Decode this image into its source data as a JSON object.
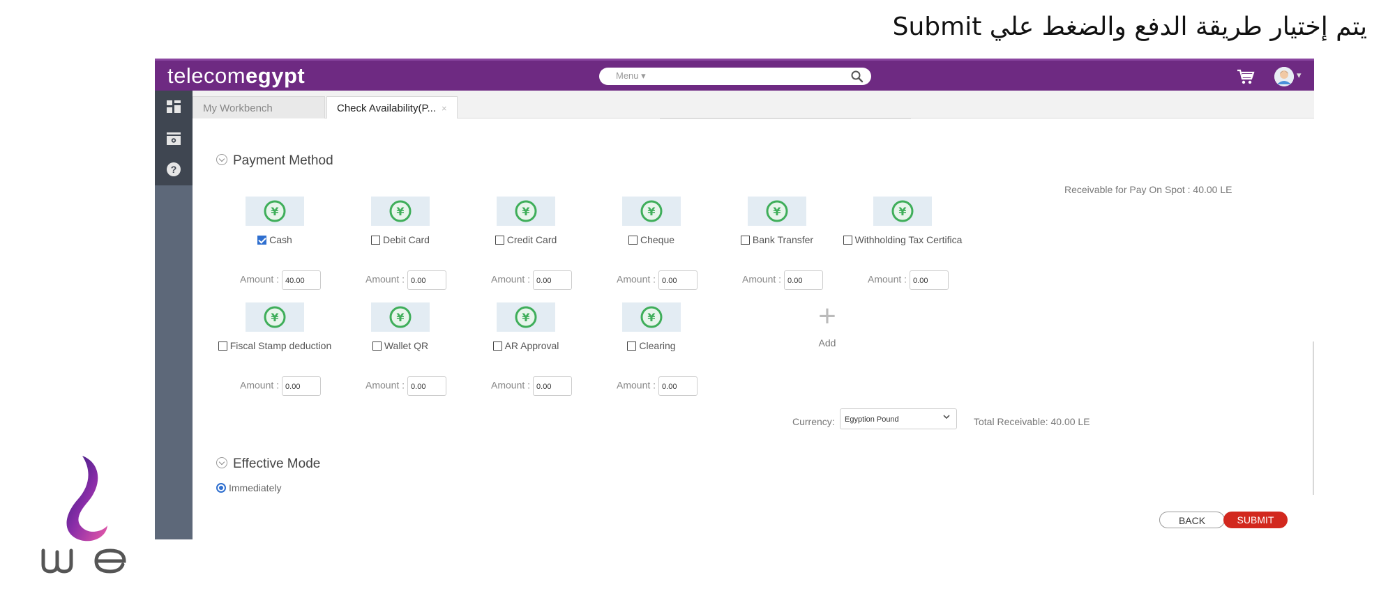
{
  "caption": "يتم إختيار طريقة الدفع والضغط علي Submit",
  "header": {
    "brand_light": "telecom",
    "brand_bold": "egypt",
    "menu_label": "Menu ▾",
    "avatar_caret": "▾"
  },
  "sidebar": {
    "icons": [
      "dashboard-icon",
      "archive-icon",
      "help-icon"
    ]
  },
  "tabs": [
    {
      "label": "My Workbench",
      "active": false
    },
    {
      "label": "Check Availability(P...",
      "active": true,
      "close": "×"
    }
  ],
  "payment": {
    "title": "Payment Method",
    "receivable_text": "Receivable for Pay On Spot : 40.00 LE",
    "amount_label": "Amount :",
    "methods": [
      {
        "label": "Cash",
        "checked": true,
        "amount": "40.00"
      },
      {
        "label": "Debit Card",
        "checked": false,
        "amount": "0.00"
      },
      {
        "label": "Credit Card",
        "checked": false,
        "amount": "0.00"
      },
      {
        "label": "Cheque",
        "checked": false,
        "amount": "0.00"
      },
      {
        "label": "Bank Transfer",
        "checked": false,
        "amount": "0.00"
      },
      {
        "label": "Withholding Tax Certifica",
        "checked": false,
        "amount": "0.00"
      },
      {
        "label": "Fiscal Stamp deduction",
        "checked": false,
        "amount": "0.00"
      },
      {
        "label": "Wallet QR",
        "checked": false,
        "amount": "0.00"
      },
      {
        "label": "AR Approval",
        "checked": false,
        "amount": "0.00"
      },
      {
        "label": "Clearing",
        "checked": false,
        "amount": "0.00"
      }
    ],
    "add_label": "Add",
    "currency_label": "Currency:",
    "currency_value": "Egyption Pound",
    "total_receivable": "Total Receivable: 40.00 LE"
  },
  "effective_mode": {
    "title": "Effective Mode",
    "option": "Immediately"
  },
  "buttons": {
    "back": "BACK",
    "submit": "SUBMIT"
  },
  "colors": {
    "header_purple": "#6e2a82",
    "submit_red": "#d2281e",
    "coin_green": "#3fae5a",
    "sidebar": "#5d6879"
  }
}
